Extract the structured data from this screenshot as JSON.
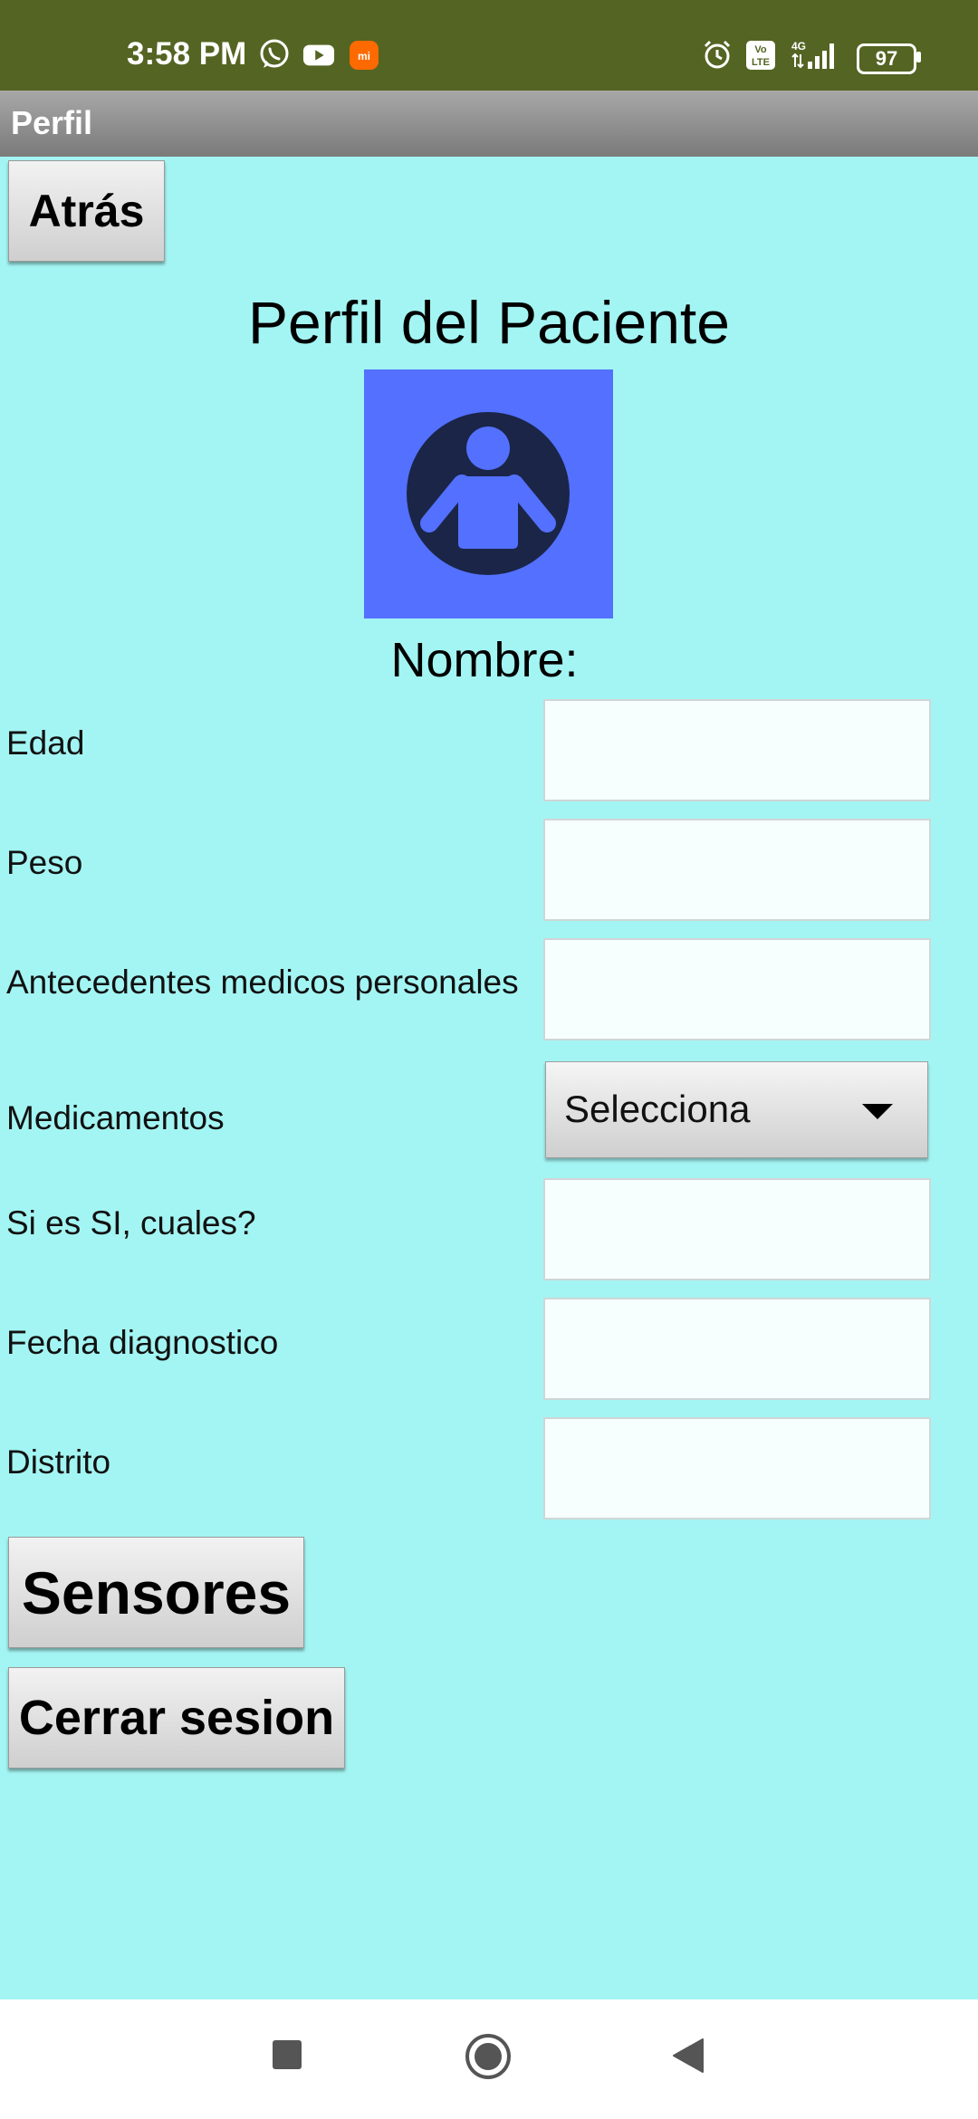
{
  "status_bar": {
    "time": "3:58 PM",
    "battery": "97",
    "icons": [
      "whatsapp-icon",
      "youtube-icon",
      "mi-app-icon",
      "alarm-icon",
      "volte-icon",
      "signal-4g-icon",
      "battery-icon"
    ]
  },
  "title_bar": {
    "title": "Perfil"
  },
  "back_button": {
    "label": "Atrás"
  },
  "heading": "Perfil del Paciente",
  "avatar": {
    "icon": "person-avatar-icon",
    "bg_color": "#5470ff",
    "fg_color": "#1a2548"
  },
  "name_label": "Nombre:",
  "fields": [
    {
      "label": "Edad",
      "value": ""
    },
    {
      "label": "Peso",
      "value": ""
    },
    {
      "label": "Antecedentes medicos personales",
      "value": ""
    },
    {
      "label": "Medicamentos",
      "selected": "Selecciona"
    },
    {
      "label": "Si es SI, cuales?",
      "value": ""
    },
    {
      "label": "Fecha diagnostico",
      "value": ""
    },
    {
      "label": "Distrito",
      "value": ""
    }
  ],
  "sensors_button": {
    "label": "Sensores"
  },
  "logout_button": {
    "label": "Cerrar sesion"
  },
  "nav_bar": {
    "icons": [
      "recents-square-icon",
      "home-circle-icon",
      "back-triangle-icon"
    ]
  },
  "colors": {
    "background": "#a3f5f3",
    "status_bar": "#546423",
    "title_bar": "#8f8f8f"
  }
}
